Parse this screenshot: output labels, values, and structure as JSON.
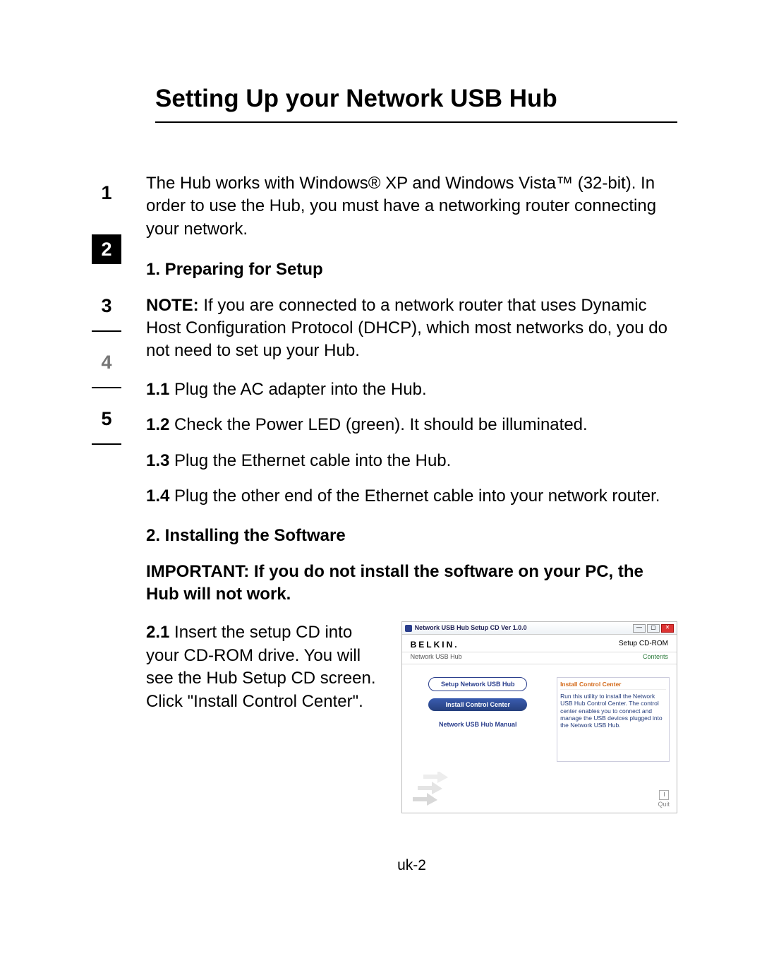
{
  "title": "Setting Up your Network USB Hub",
  "tabs": [
    "1",
    "2",
    "3",
    "4",
    "5"
  ],
  "active_tab_index": 1,
  "intro": "The Hub works with Windows® XP and Windows Vista™ (32-bit). In order to use the Hub, you must have a networking router connecting your network.",
  "s1": {
    "heading": "1. Preparing for Setup",
    "note_prefix": "NOTE:",
    "note_body": " If you are connected to a network router that uses Dynamic Host Configuration Protocol (DHCP), which most networks do, you do not need to set up your Hub.",
    "steps": [
      {
        "n": "1.1",
        "t": " Plug the AC adapter into the Hub."
      },
      {
        "n": "1.2",
        "t": " Check the Power LED (green). It should be illuminated."
      },
      {
        "n": "1.3",
        "t": " Plug the Ethernet cable into the Hub."
      },
      {
        "n": "1.4",
        "t": " Plug the other end of the Ethernet cable into your network router."
      }
    ]
  },
  "s2": {
    "heading": "2. Installing the Software",
    "important": "IMPORTANT: If you do not install the software on your PC, the Hub will not work.",
    "step21_n": "2.1",
    "step21_t": " Insert the setup CD into your CD-ROM drive. You will see the Hub Setup CD screen. Click \"Install Control Center\"."
  },
  "cd": {
    "titlebar": "Network USB Hub Setup CD Ver 1.0.0",
    "brand": "BELKIN",
    "setup_label": "Setup CD-ROM",
    "subproduct": "Network USB Hub",
    "contents_label": "Contents",
    "buttons": {
      "setup": "Setup Network USB Hub",
      "install": "Install Control Center",
      "manual": "Network USB Hub Manual"
    },
    "panel_heading": "Install Control Center",
    "panel_body": "Run this utility to install the Network USB Hub Control Center. The control center enables you to connect and manage the USB devices plugged into the Network USB Hub.",
    "exit": "Quit",
    "win_min": "—",
    "win_max": "▢",
    "win_close": "✕"
  },
  "page_number": "uk-2"
}
